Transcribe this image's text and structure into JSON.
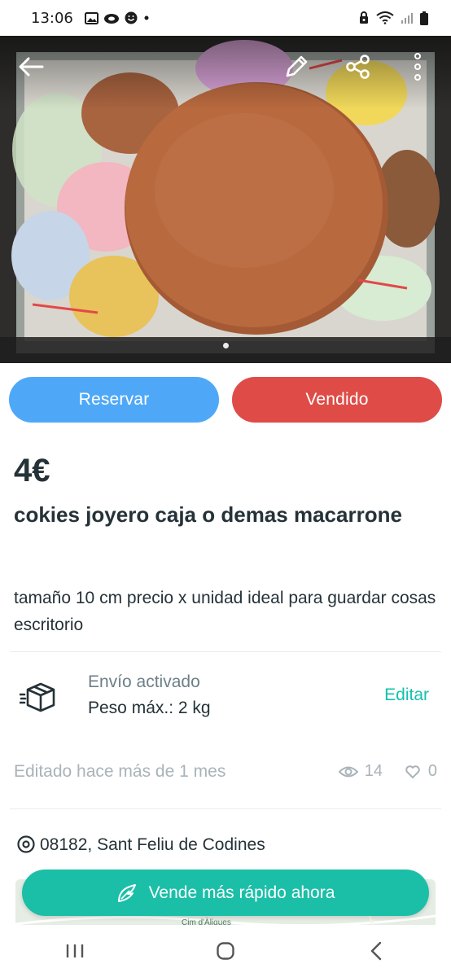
{
  "status_bar": {
    "time": "13:06",
    "left_icons": [
      "gallery-icon",
      "cloud-icon",
      "face-icon",
      "dot-icon"
    ],
    "right_icons": [
      "alarm-icon",
      "wifi-icon",
      "signal-icon",
      "battery-icon"
    ]
  },
  "photo": {
    "alt": "",
    "page_count": 1,
    "current_page": 1
  },
  "header_actions": {
    "back_icon": "arrow-left-icon",
    "edit_icon": "pencil-icon",
    "share_icon": "share-icon",
    "more_icon": "more-vertical-icon"
  },
  "actions": {
    "reserve_label": "Reservar",
    "sold_label": "Vendido"
  },
  "listing": {
    "price": "4€",
    "title": "cokies joyero caja o demas macarrone",
    "description": "tamaño 10 cm precio x unidad ideal para guardar cosas escritorio"
  },
  "shipping": {
    "title": "Envío activado",
    "weight": "Peso máx.: 2 kg",
    "edit_label": "Editar"
  },
  "meta": {
    "edited": "Editado hace más de 1 mes",
    "views": "14",
    "favorites": "0"
  },
  "location": {
    "text": "08182, Sant Feliu de Codines"
  },
  "map": {
    "label": "Cim d'Àligues"
  },
  "cta": {
    "label": "Vende más rápido ahora"
  },
  "colors": {
    "reserve": "#4fa8f7",
    "sold": "#df4c47",
    "accent": "#13c1ac",
    "text": "#253238",
    "muted": "#a9b3b8"
  }
}
